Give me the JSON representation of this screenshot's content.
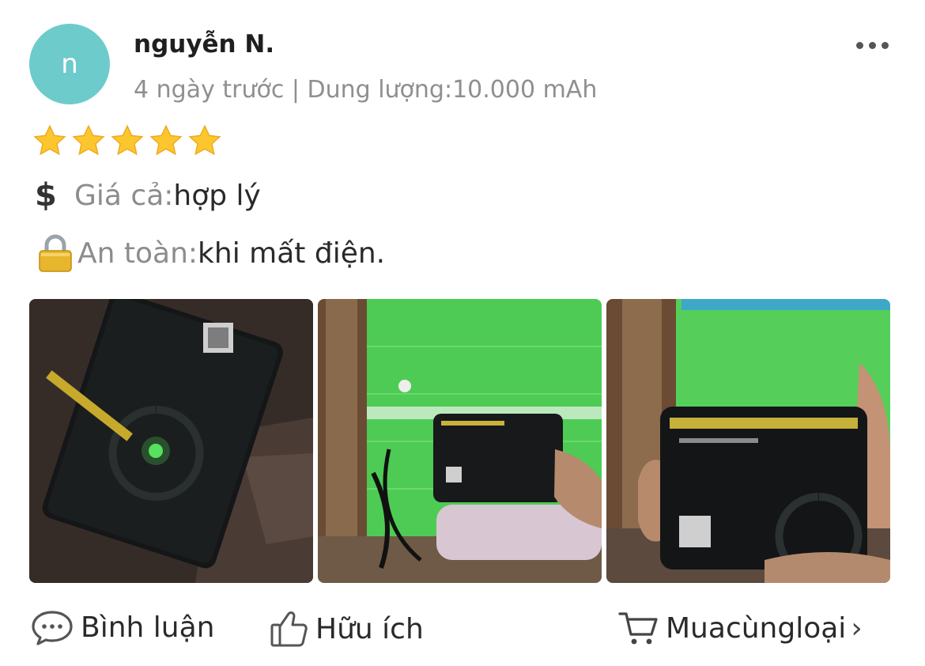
{
  "review": {
    "avatar_initial": "n",
    "username": "nguyễn N.",
    "meta": "4 ngày trước | Dung lượng:10.000 mAh",
    "rating": 5,
    "attributes": {
      "price_label": "Giá cả:",
      "price_value": "hợp lý",
      "safety_label": "An toàn:",
      "safety_value": "khi mất điện."
    }
  },
  "actions": {
    "comment_label": "Bình luận",
    "helpful_label": "Hữu ích",
    "buy_label": "Muacùngloại"
  },
  "icons": {
    "more": "more-dots-icon",
    "star": "star-icon",
    "dollar": "dollar-icon",
    "lock": "lock-icon",
    "comment": "chat-bubble-icon",
    "helpful": "thumbs-up-icon",
    "cart": "shopping-cart-icon",
    "chevron": "chevron-right-icon"
  },
  "colors": {
    "avatar_bg": "#6dcbcb",
    "star": "#fcc72e",
    "meta_text": "#8f8f8f"
  }
}
